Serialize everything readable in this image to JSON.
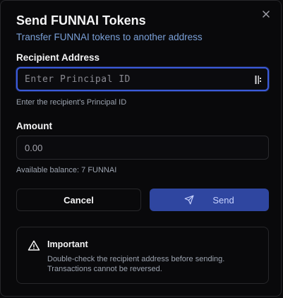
{
  "dialog": {
    "title": "Send FUNNAI Tokens",
    "subtitle": "Transfer FUNNAI tokens to another address",
    "close_icon": "close-icon"
  },
  "recipient": {
    "label": "Recipient Address",
    "placeholder": "Enter Principal ID",
    "value": "",
    "hint": "Enter the recipient's Principal ID",
    "icon": "password-manager-icon"
  },
  "amount": {
    "label": "Amount",
    "placeholder": "0.00",
    "value": "",
    "hint": "Available balance: 7 FUNNAI"
  },
  "actions": {
    "cancel_label": "Cancel",
    "send_label": "Send",
    "send_icon": "send-icon"
  },
  "notice": {
    "icon": "warning-icon",
    "title": "Important",
    "body": "Double-check the recipient address before sending. Transactions cannot be reversed."
  },
  "colors": {
    "background": "#09090b",
    "accent": "#2f46a0",
    "focus_ring": "#3b5bdb",
    "subtitle": "#7aa0d8"
  }
}
